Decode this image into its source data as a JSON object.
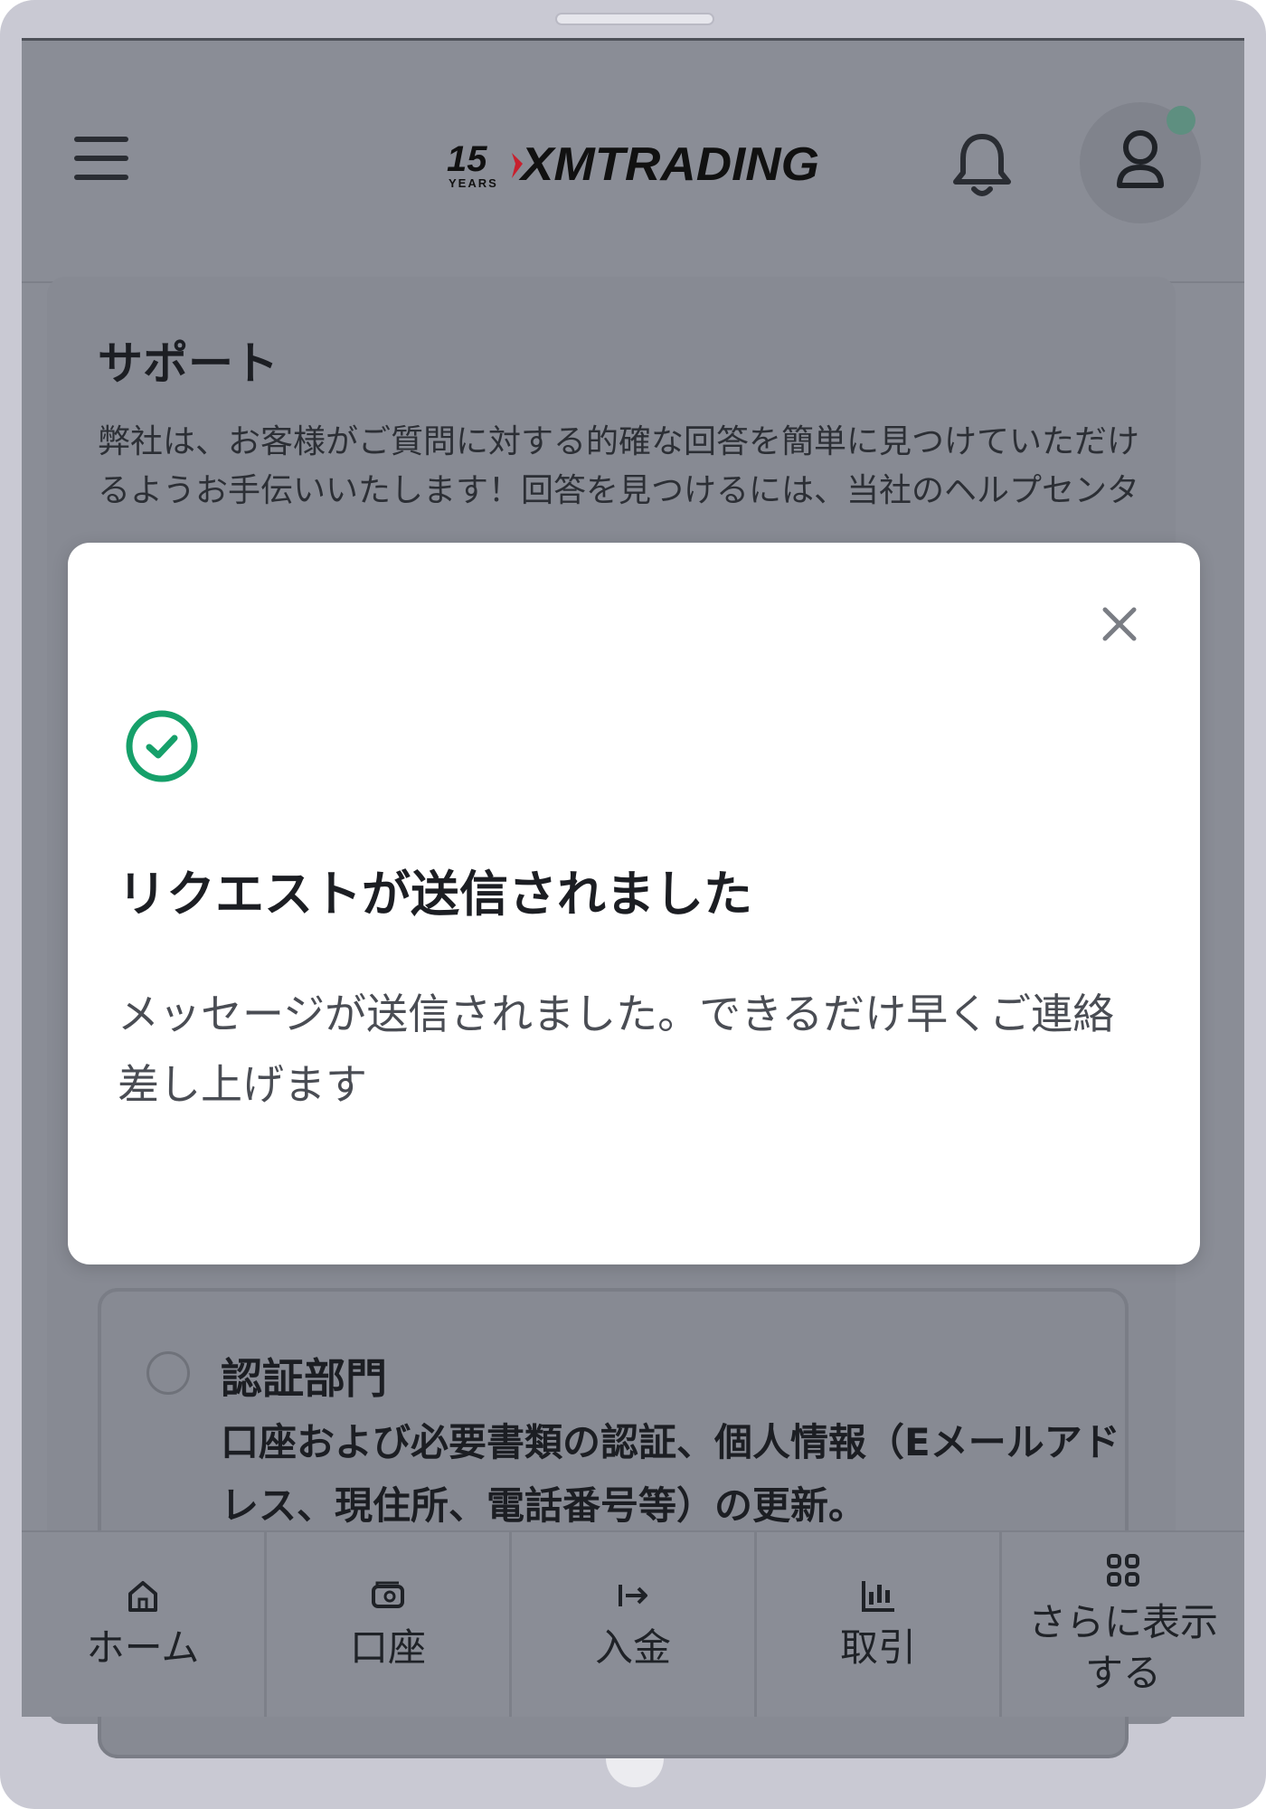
{
  "header": {
    "logo_years_number": "15",
    "logo_years_word": "YEARS",
    "logo_brand": "XMTRADING"
  },
  "support": {
    "title": "サポート",
    "description": "弊社は、お客様がご質問に対する的確な回答を簡単に見つけていただけるようお手伝いいたします！回答を見つけるには、当社のヘルプセンターページ"
  },
  "option": {
    "title": "認証部門",
    "description": "口座および必要書類の認証、個人情報（Eメールアドレス、現住所、電話番号等）の更新。"
  },
  "modal": {
    "title": "リクエストが送信されました",
    "message": "メッセージが送信されました。できるだけ早くご連絡差し上げます"
  },
  "bottom_nav": [
    {
      "label": "ホーム",
      "icon": "home-icon"
    },
    {
      "label": "口座",
      "icon": "wallet-icon"
    },
    {
      "label": "入金",
      "icon": "deposit-icon"
    },
    {
      "label": "取引",
      "icon": "chart-icon"
    },
    {
      "label": "さらに表示する",
      "icon": "grid-icon"
    }
  ],
  "colors": {
    "success": "#16a06a",
    "overlay_bg": "#8a8d96",
    "brand_red": "#c8202e"
  }
}
